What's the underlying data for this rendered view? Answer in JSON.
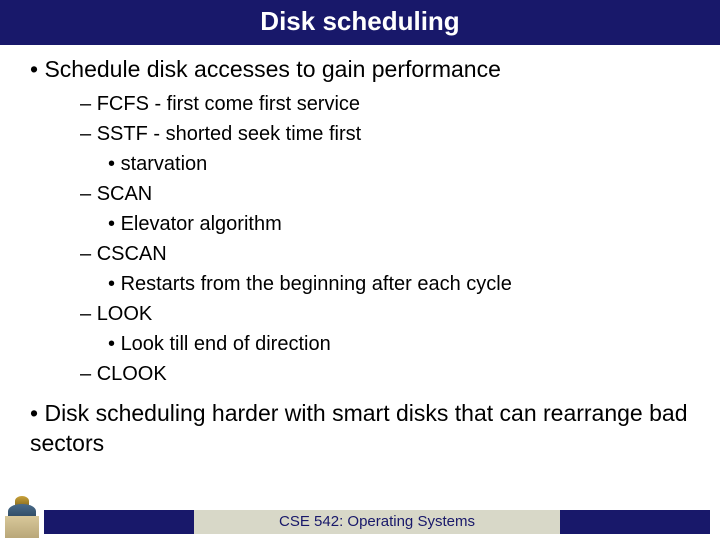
{
  "title": "Disk scheduling",
  "points": {
    "p1": "Schedule disk accesses to gain performance",
    "p1_sub": {
      "a": "FCFS - first come first service",
      "b": "SSTF - shorted seek time first",
      "b1": "starvation",
      "c": "SCAN",
      "c1": "Elevator algorithm",
      "d": "CSCAN",
      "d1": "Restarts from the beginning after each cycle",
      "e": "LOOK",
      "e1": "Look till end of direction",
      "f": "CLOOK"
    },
    "p2": "Disk scheduling harder with smart disks that can rearrange bad sectors"
  },
  "footer": {
    "course": "CSE 542: Operating Systems"
  }
}
